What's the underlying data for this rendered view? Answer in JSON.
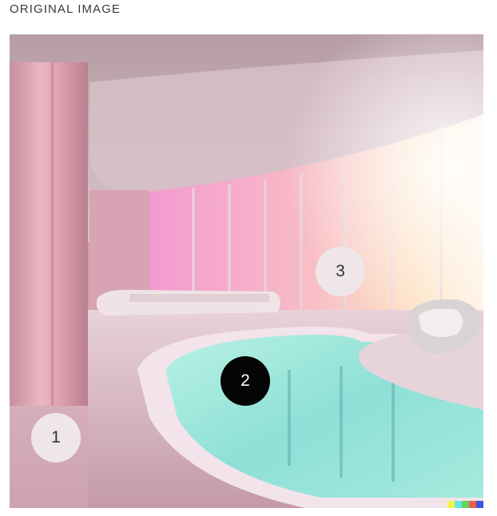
{
  "caption": "ORIGINAL IMAGE",
  "image": {
    "description_icon": "generated-image-pink-pool-lounge"
  },
  "markers": [
    {
      "label": "1",
      "state": "default"
    },
    {
      "label": "2",
      "state": "selected"
    },
    {
      "label": "3",
      "state": "default"
    }
  ],
  "watermark_colors": [
    "#f5f14a",
    "#66e3e3",
    "#5fd35f",
    "#ef5d4f",
    "#3a57d8"
  ],
  "colors": {
    "marker_light": "#efe6e9",
    "marker_dark": "#050505",
    "pool_water": "#9fe5dc",
    "wall_pink": "#d9a5b3"
  }
}
